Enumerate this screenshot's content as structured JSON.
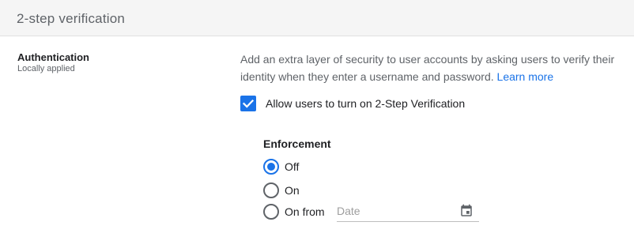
{
  "header": {
    "title": "2-step verification"
  },
  "setting": {
    "name": "Authentication",
    "scope": "Locally applied",
    "description": "Add an extra layer of security to user accounts by asking users to verify their identity when they enter a username and password.",
    "learn_more_label": "Learn more"
  },
  "allow_checkbox": {
    "label": "Allow users to turn on 2-Step Verification",
    "checked": true
  },
  "enforcement": {
    "title": "Enforcement",
    "selected": "Off",
    "options": [
      {
        "label": "Off"
      },
      {
        "label": "On"
      },
      {
        "label": "On from"
      }
    ],
    "date_placeholder": "Date",
    "date_value": ""
  },
  "colors": {
    "accent": "#1a73e8",
    "header_bg": "#f5f5f5",
    "secondary_text": "#5f6368"
  }
}
